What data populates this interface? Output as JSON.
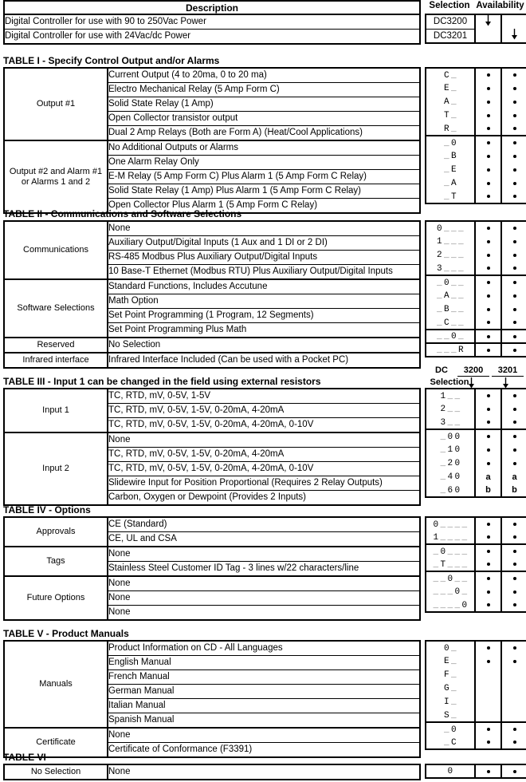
{
  "header": {
    "description_label": "Description",
    "selection_label": "Selection",
    "availability_label": "Availability",
    "rows": [
      {
        "desc": "Digital Controller for use with 90 to 250Vac Power",
        "sel": "DC3200",
        "av1": "arrow",
        "av2": ""
      },
      {
        "desc": "Digital Controller for use with 24Vac/dc Power",
        "sel": "DC3201",
        "av1": "",
        "av2": "arrow"
      }
    ]
  },
  "table3_header": {
    "dc_label": "DC",
    "col1": "3200",
    "col2": "3201",
    "selection_label": "Selection"
  },
  "tables": [
    {
      "caption": "TABLE I - Specify Control Output and/or Alarms",
      "groups": [
        {
          "label": "Output #1",
          "rows": [
            {
              "desc": "Current Output  (4 to 20ma, 0 to 20 ma)",
              "code": [
                "C",
                "_"
              ],
              "av1": "dot",
              "av2": "dot"
            },
            {
              "desc": "Electro Mechanical Relay (5 Amp Form C)",
              "code": [
                "E",
                "_"
              ],
              "av1": "dot",
              "av2": "dot"
            },
            {
              "desc": "Solid State Relay (1 Amp)",
              "code": [
                "A",
                "_"
              ],
              "av1": "dot",
              "av2": "dot"
            },
            {
              "desc": "Open Collector transistor output",
              "code": [
                "T",
                "_"
              ],
              "av1": "dot",
              "av2": "dot"
            },
            {
              "desc": "Dual 2 Amp Relays (Both are Form A) (Heat/Cool Applications)",
              "code": [
                "R",
                "_"
              ],
              "av1": "dot",
              "av2": "dot"
            }
          ]
        },
        {
          "label": "Output #2 and Alarm #1 or Alarms 1 and 2",
          "rows": [
            {
              "desc": "No Additional Outputs or Alarms",
              "code": [
                "_",
                "0"
              ],
              "av1": "dot",
              "av2": "dot"
            },
            {
              "desc": "One Alarm Relay Only",
              "code": [
                "_",
                "B"
              ],
              "av1": "dot",
              "av2": "dot"
            },
            {
              "desc": "E-M Relay (5 Amp Form C) Plus Alarm 1 (5 Amp Form C Relay)",
              "code": [
                "_",
                "E"
              ],
              "av1": "dot",
              "av2": "dot"
            },
            {
              "desc": "Solid State Relay (1 Amp) Plus  Alarm 1 (5 Amp Form C Relay)",
              "code": [
                "_",
                "A"
              ],
              "av1": "dot",
              "av2": "dot"
            },
            {
              "desc": "Open Collector Plus Alarm 1 (5 Amp Form C Relay)",
              "code": [
                "_",
                "T"
              ],
              "av1": "dot",
              "av2": "dot"
            }
          ]
        }
      ]
    },
    {
      "caption": "TABLE II - Communications and Software Selections",
      "groups": [
        {
          "label": "Communications",
          "rows": [
            {
              "desc": "None",
              "code": [
                "0",
                "_",
                "_",
                "_"
              ],
              "av1": "dot",
              "av2": "dot"
            },
            {
              "desc": "Auxiliary Output/Digital Inputs  (1 Aux and 1 DI or 2 DI)",
              "code": [
                "1",
                "_",
                "_",
                "_"
              ],
              "av1": "dot",
              "av2": "dot"
            },
            {
              "desc": "RS-485 Modbus Plus Auxiliary Output/Digital Inputs",
              "code": [
                "2",
                "_",
                "_",
                "_"
              ],
              "av1": "dot",
              "av2": "dot"
            },
            {
              "desc": "10 Base-T Ethernet (Modbus RTU) Plus Auxiliary Output/Digital Inputs",
              "code": [
                "3",
                "_",
                "_",
                "_"
              ],
              "av1": "dot",
              "av2": "dot"
            }
          ]
        },
        {
          "label": "Software Selections",
          "rows": [
            {
              "desc": "Standard Functions, Includes Accutune",
              "code": [
                "_",
                "0",
                "_",
                "_"
              ],
              "av1": "dot",
              "av2": "dot"
            },
            {
              "desc": "Math Option",
              "code": [
                "_",
                "A",
                "_",
                "_"
              ],
              "av1": "dot",
              "av2": "dot"
            },
            {
              "desc": "Set Point Programming (1 Program, 12 Segments)",
              "code": [
                "_",
                "B",
                "_",
                "_"
              ],
              "av1": "dot",
              "av2": "dot"
            },
            {
              "desc": "Set Point Programming Plus Math",
              "code": [
                "_",
                "C",
                "_",
                "_"
              ],
              "av1": "dot",
              "av2": "dot"
            }
          ]
        },
        {
          "label": "Reserved",
          "rows": [
            {
              "desc": "No Selection",
              "code": [
                "_",
                "_",
                "0",
                "_"
              ],
              "av1": "dot",
              "av2": "dot"
            }
          ]
        },
        {
          "label": "Infrared interface",
          "rows": [
            {
              "desc": "Infrared Interface Included (Can be used with a Pocket PC)",
              "code": [
                "_",
                "_",
                "_",
                "R"
              ],
              "av1": "dot",
              "av2": "dot"
            }
          ]
        }
      ]
    },
    {
      "caption": "TABLE III - Input 1 can be changed in the field using external resistors",
      "groups": [
        {
          "label": "Input 1",
          "rows": [
            {
              "desc": "TC, RTD, mV, 0-5V, 1-5V",
              "code": [
                "1",
                "_",
                "_"
              ],
              "av1": "dot",
              "av2": "dot"
            },
            {
              "desc": "TC, RTD, mV, 0-5V, 1-5V, 0-20mA, 4-20mA",
              "code": [
                "2",
                "_",
                "_"
              ],
              "av1": "dot",
              "av2": "dot"
            },
            {
              "desc": "TC, RTD, mV, 0-5V, 1-5V, 0-20mA, 4-20mA, 0-10V",
              "code": [
                "3",
                "_",
                "_"
              ],
              "av1": "dot",
              "av2": "dot"
            }
          ]
        },
        {
          "label": "Input 2",
          "rows": [
            {
              "desc": "None",
              "code": [
                "_",
                "0",
                "0"
              ],
              "av1": "dot",
              "av2": "dot"
            },
            {
              "desc": "TC, RTD, mV, 0-5V, 1-5V, 0-20mA, 4-20mA",
              "code": [
                "_",
                "1",
                "0"
              ],
              "av1": "dot",
              "av2": "dot"
            },
            {
              "desc": "TC, RTD, mV, 0-5V, 1-5V, 0-20mA, 4-20mA, 0-10V",
              "code": [
                "_",
                "2",
                "0"
              ],
              "av1": "dot",
              "av2": "dot"
            },
            {
              "desc": "Slidewire Input for Position Proportional (Requires 2 Relay Outputs)",
              "code": [
                "_",
                "4",
                "0"
              ],
              "av1": "a",
              "av2": "a"
            },
            {
              "desc": "Carbon, Oxygen or Dewpoint (Provides 2 Inputs)",
              "code": [
                "_",
                "6",
                "0"
              ],
              "av1": "b",
              "av2": "b"
            }
          ]
        }
      ]
    },
    {
      "caption": "TABLE IV - Options",
      "groups": [
        {
          "label": "Approvals",
          "rows": [
            {
              "desc": "CE  (Standard)",
              "code": [
                "0",
                "_",
                "_",
                "_",
                "_"
              ],
              "av1": "dot",
              "av2": "dot"
            },
            {
              "desc": "CE, UL and CSA",
              "code": [
                "1",
                "_",
                "_",
                "_",
                "_"
              ],
              "av1": "dot",
              "av2": "dot"
            }
          ]
        },
        {
          "label": "Tags",
          "rows": [
            {
              "desc": "None",
              "code": [
                "_",
                "0",
                "_",
                "_",
                "_"
              ],
              "av1": "dot",
              "av2": "dot"
            },
            {
              "desc": "Stainless Steel Customer ID Tag - 3 lines w/22 characters/line",
              "code": [
                "_",
                "T",
                "_",
                "_",
                "_"
              ],
              "av1": "dot",
              "av2": "dot"
            }
          ]
        },
        {
          "label": "Future Options",
          "divided": true,
          "rows": [
            {
              "desc": "None",
              "code": [
                "_",
                "_",
                "0",
                "_",
                "_"
              ],
              "av1": "dot",
              "av2": "dot"
            },
            {
              "desc": "None",
              "code": [
                "_",
                "_",
                "_",
                "0",
                "_"
              ],
              "av1": "dot",
              "av2": "dot"
            },
            {
              "desc": "None",
              "code": [
                "_",
                "_",
                "_",
                "_",
                "0"
              ],
              "av1": "dot",
              "av2": "dot"
            }
          ]
        }
      ]
    },
    {
      "caption": "TABLE V - Product Manuals",
      "groups": [
        {
          "label": "Manuals",
          "rows": [
            {
              "desc": "Product Information on CD - All Languages",
              "code": [
                "0",
                "_"
              ],
              "av1": "dot",
              "av2": "dot"
            },
            {
              "desc": "English Manual",
              "code": [
                "E",
                "_"
              ],
              "av1": "dot",
              "av2": "dot"
            },
            {
              "desc": "French Manual",
              "code": [
                "F",
                "_"
              ],
              "av1": "",
              "av2": ""
            },
            {
              "desc": "German Manual",
              "code": [
                "G",
                "_"
              ],
              "av1": "",
              "av2": ""
            },
            {
              "desc": "Italian Manual",
              "code": [
                "I",
                "_"
              ],
              "av1": "",
              "av2": ""
            },
            {
              "desc": "Spanish Manual",
              "code": [
                "S",
                "_"
              ],
              "av1": "",
              "av2": ""
            }
          ]
        },
        {
          "label": "Certificate",
          "rows": [
            {
              "desc": "None",
              "code": [
                "_",
                "0"
              ],
              "av1": "dot",
              "av2": "dot"
            },
            {
              "desc": "Certificate of Conformance (F3391)",
              "code": [
                "_",
                "C"
              ],
              "av1": "dot",
              "av2": "dot"
            }
          ]
        }
      ]
    },
    {
      "caption": "TABLE VI",
      "groups": [
        {
          "label": "No Selection",
          "rows": [
            {
              "desc": "None",
              "code": [
                "0"
              ],
              "av1": "dot",
              "av2": "dot"
            }
          ]
        }
      ]
    }
  ]
}
